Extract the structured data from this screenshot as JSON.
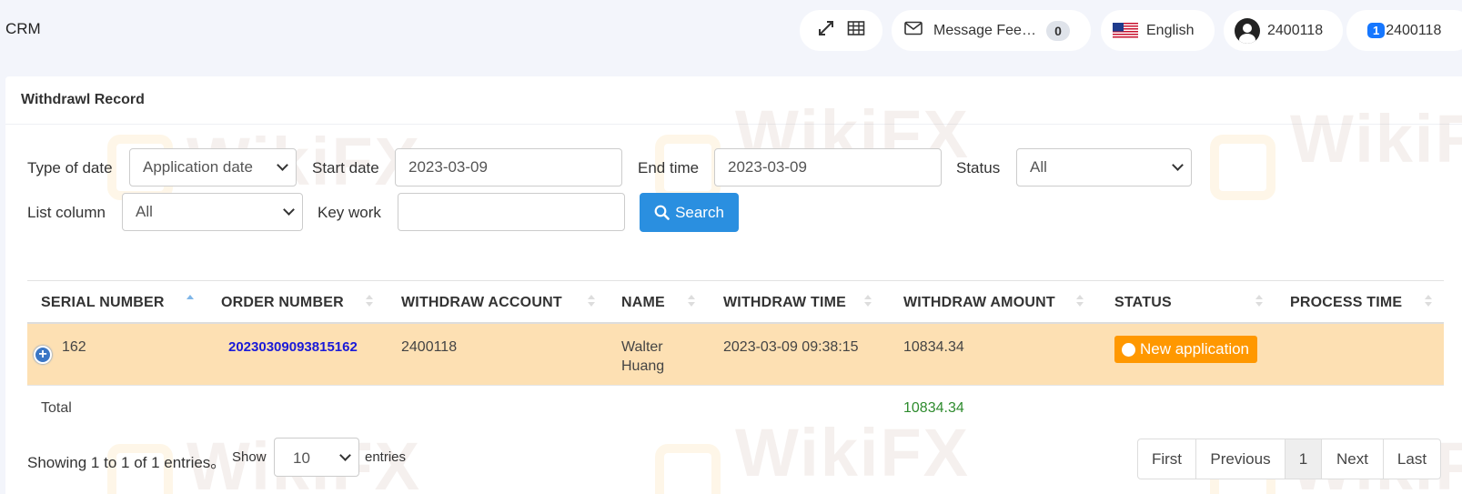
{
  "header": {
    "brand": "CRM",
    "message_label": "Message Feedback",
    "message_count": "0",
    "language": "English",
    "user_id": "2400118",
    "notif_count": "1",
    "account_id": "2400118"
  },
  "panel": {
    "title": "Withdrawl Record"
  },
  "filters": {
    "type_of_date_label": "Type of date",
    "type_of_date_value": "Application date",
    "start_date_label": "Start date",
    "start_date_value": "2023-03-09",
    "end_time_label": "End time",
    "end_time_value": "2023-03-09",
    "status_label": "Status",
    "status_value": "All",
    "list_column_label": "List column",
    "list_column_value": "All",
    "key_work_label": "Key work",
    "key_work_value": "",
    "search_label": "Search"
  },
  "table": {
    "columns": [
      "SERIAL NUMBER",
      "ORDER NUMBER",
      "WITHDRAW ACCOUNT",
      "NAME",
      "WITHDRAW TIME",
      "WITHDRAW AMOUNT",
      "STATUS",
      "PROCESS TIME"
    ],
    "rows": [
      {
        "serial": "162",
        "order": "20230309093815162",
        "account": "2400118",
        "name": "Walter Huang",
        "time": "2023-03-09 09:38:15",
        "amount": "10834.34",
        "status": "New application",
        "process_time": ""
      }
    ],
    "total_label": "Total",
    "total_amount": "10834.34"
  },
  "footer": {
    "info": "Showing 1 to 1 of 1 entries。",
    "show_label": "Show",
    "page_length": "10",
    "entries_label": "entries",
    "pages": [
      "First",
      "Previous",
      "1",
      "Next",
      "Last"
    ]
  },
  "watermark": "WikiFX",
  "colors": {
    "accent": "#2a8fe0",
    "row_highlight": "#fde0b3",
    "status_new": "#ff9800",
    "total_green": "#2e8b2e",
    "order_link": "#1a1ad8"
  }
}
